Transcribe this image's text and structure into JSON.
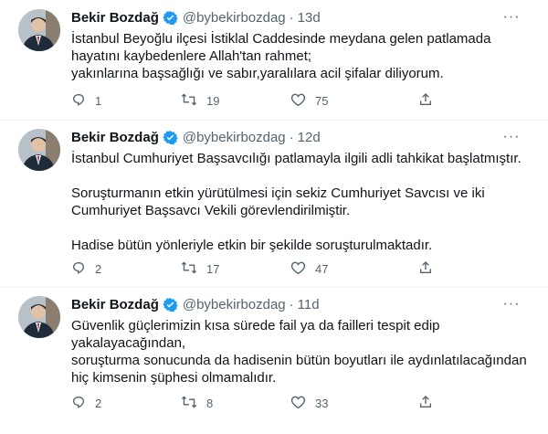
{
  "tweets": [
    {
      "author_name": "Bekir Bozdağ",
      "handle": "@bybekirbozdag",
      "separator": "·",
      "time": "13d",
      "paragraphs": [
        "İstanbul Beyoğlu ilçesi İstiklal Caddesinde meydana gelen patlamada",
        "hayatını kaybedenlere Allah'tan rahmet;",
        "yakınlarına başsağlığı ve sabır,yaralılara acil şifalar diliyorum."
      ],
      "replies": "1",
      "retweets": "19",
      "likes": "75"
    },
    {
      "author_name": "Bekir Bozdağ",
      "handle": "@bybekirbozdag",
      "separator": "·",
      "time": "12d",
      "paragraphs": [
        "İstanbul Cumhuriyet Başsavcılığı patlamayla ilgili adli tahkikat başlatmıştır.",
        "Soruşturmanın etkin yürütülmesi için sekiz Cumhuriyet Savcısı ve iki",
        "Cumhuriyet Başsavcı Vekili görevlendirilmiştir.",
        "Hadise bütün yönleriyle etkin bir şekilde soruşturulmaktadır."
      ],
      "replies": "2",
      "retweets": "17",
      "likes": "47"
    },
    {
      "author_name": "Bekir Bozdağ",
      "handle": "@bybekirbozdag",
      "separator": "·",
      "time": "11d",
      "paragraphs": [
        "Güvenlik güçlerimizin kısa sürede fail ya da failleri tespit edip",
        "yakalayacağından,",
        "soruşturma sonucunda da hadisenin bütün boyutları ile aydınlatılacağından",
        "hiç kimsenin şüphesi olmamalıdır."
      ],
      "replies": "2",
      "retweets": "8",
      "likes": "33"
    }
  ],
  "more_glyph": "···",
  "icons": {
    "verified": "verified-badge-icon",
    "reply": "reply-icon",
    "retweet": "retweet-icon",
    "like": "heart-icon",
    "share": "share-icon",
    "more": "more-icon"
  },
  "colors": {
    "verified_blue": "#1d9bf0",
    "secondary_text": "#536471",
    "primary_text": "#0f1419",
    "divider": "#eff3f4"
  }
}
